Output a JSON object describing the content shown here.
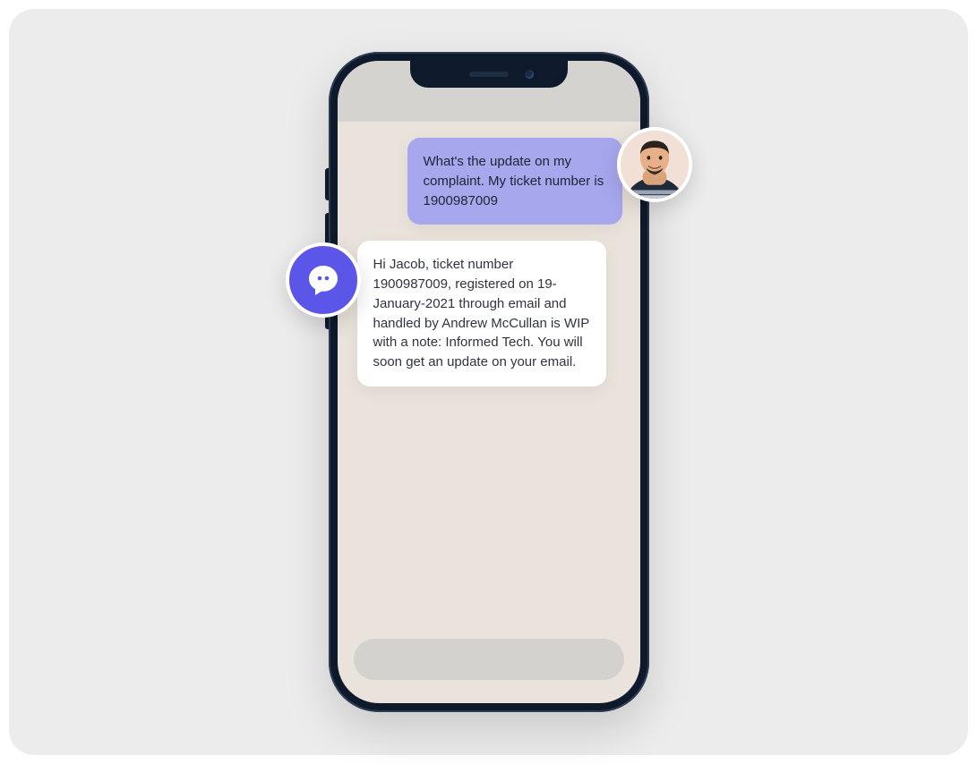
{
  "chat": {
    "user_message": "What's the update on my complaint. My ticket number is 1900987009",
    "bot_message": "Hi Jacob, ticket number 1900987009, registered on 19-January-2021 through email and handled by Andrew McCullan is WIP with a note: Informed Tech. You will soon get an update on your email."
  },
  "icons": {
    "bot": "chat-bubble-icon",
    "user": "person-avatar"
  },
  "colors": {
    "stage_bg": "#ececec",
    "screen_bg": "#eae3db",
    "user_bubble": "#a7a7ee",
    "bot_bubble": "#ffffff",
    "bot_avatar": "#5b55e8"
  }
}
